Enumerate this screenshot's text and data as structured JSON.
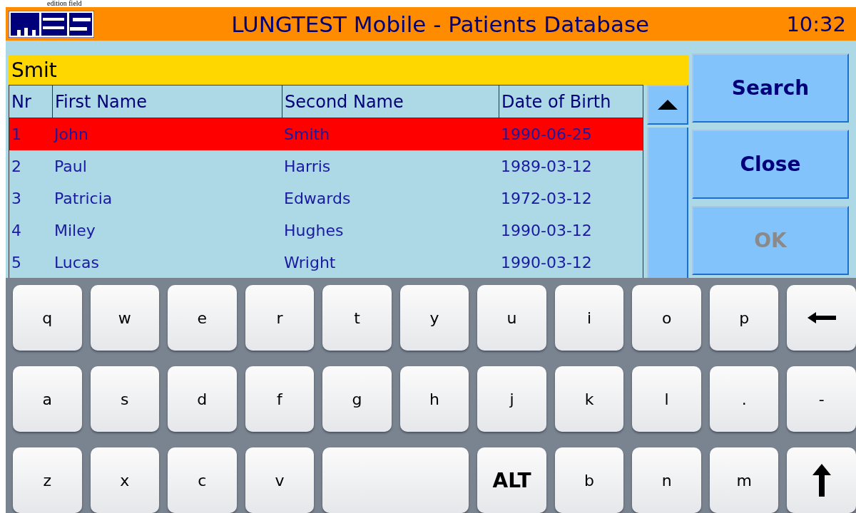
{
  "caption": "edition field",
  "header": {
    "title": "LUNGTEST Mobile - Patients Database",
    "time": "10:32"
  },
  "search_field": {
    "value": "Smit"
  },
  "table": {
    "columns": [
      "Nr",
      "First Name",
      "Second Name",
      "Date of Birth"
    ],
    "rows": [
      {
        "cells": [
          "1",
          "John",
          "Smith",
          "1990-06-25"
        ],
        "selected": true
      },
      {
        "cells": [
          "2",
          "Paul",
          "Harris",
          "1989-03-12"
        ],
        "selected": false
      },
      {
        "cells": [
          "3",
          "Patricia",
          "Edwards",
          "1972-03-12"
        ],
        "selected": false
      },
      {
        "cells": [
          "4",
          "Miley",
          "Hughes",
          "1990-03-12"
        ],
        "selected": false
      },
      {
        "cells": [
          "5",
          "Lucas",
          "Wright",
          "1990-03-12"
        ],
        "selected": false
      }
    ]
  },
  "buttons": [
    {
      "label": "Search",
      "disabled": false
    },
    {
      "label": "Close",
      "disabled": false
    },
    {
      "label": "OK",
      "disabled": true
    }
  ],
  "keyboard": [
    [
      {
        "kind": "char",
        "label": "q"
      },
      {
        "kind": "char",
        "label": "w"
      },
      {
        "kind": "char",
        "label": "e"
      },
      {
        "kind": "char",
        "label": "r"
      },
      {
        "kind": "char",
        "label": "t"
      },
      {
        "kind": "char",
        "label": "y"
      },
      {
        "kind": "char",
        "label": "u"
      },
      {
        "kind": "char",
        "label": "i"
      },
      {
        "kind": "char",
        "label": "o"
      },
      {
        "kind": "char",
        "label": "p"
      },
      {
        "kind": "backspace"
      }
    ],
    [
      {
        "kind": "char",
        "label": "a"
      },
      {
        "kind": "char",
        "label": "s"
      },
      {
        "kind": "char",
        "label": "d"
      },
      {
        "kind": "char",
        "label": "f"
      },
      {
        "kind": "char",
        "label": "g"
      },
      {
        "kind": "char",
        "label": "h"
      },
      {
        "kind": "char",
        "label": "j"
      },
      {
        "kind": "char",
        "label": "k"
      },
      {
        "kind": "char",
        "label": "l"
      },
      {
        "kind": "char",
        "label": "."
      },
      {
        "kind": "char",
        "label": "-"
      }
    ],
    [
      {
        "kind": "char",
        "label": "z"
      },
      {
        "kind": "char",
        "label": "x"
      },
      {
        "kind": "char",
        "label": "c"
      },
      {
        "kind": "char",
        "label": "v"
      },
      {
        "kind": "space"
      },
      {
        "kind": "alt",
        "label": "ALT"
      },
      {
        "kind": "char",
        "label": "b"
      },
      {
        "kind": "char",
        "label": "n"
      },
      {
        "kind": "char",
        "label": "m"
      },
      {
        "kind": "shift"
      }
    ]
  ]
}
